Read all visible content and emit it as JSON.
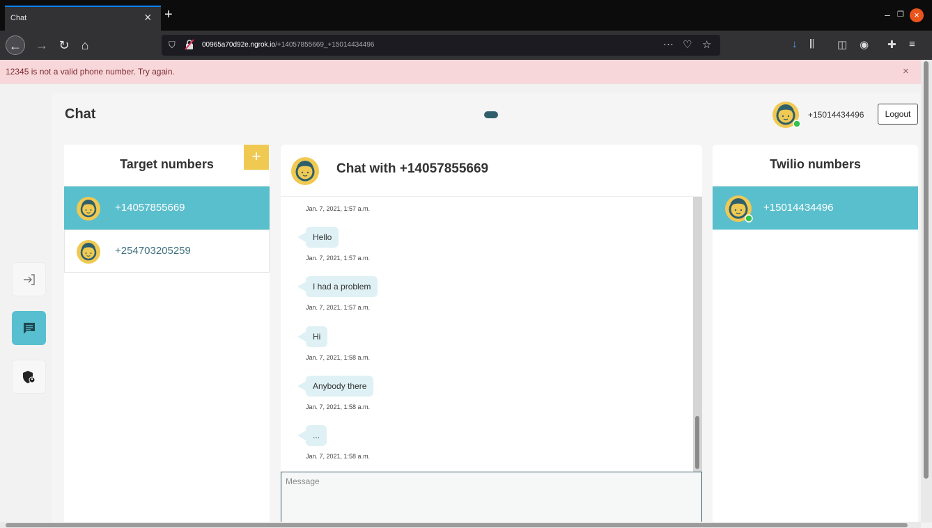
{
  "browser": {
    "tab_title": "Chat",
    "url_host": "00965a70d92e.ngrok.io",
    "url_path": "/+14057855669_+15014434496"
  },
  "alert": {
    "message": "12345 is not a valid phone number. Try again.",
    "close": "×"
  },
  "app": {
    "title": "Chat",
    "user_number": "+15014434496",
    "logout_label": "Logout"
  },
  "target_panel": {
    "title": "Target numbers",
    "add_label": "+",
    "items": [
      {
        "number": "+14057855669",
        "selected": true
      },
      {
        "number": "+254703205259",
        "selected": false
      }
    ]
  },
  "chat": {
    "title": "Chat with +14057855669",
    "first_timestamp": "Jan. 7, 2021, 1:57 a.m.",
    "messages": [
      {
        "text": "Hello",
        "time": "Jan. 7, 2021, 1:57 a.m."
      },
      {
        "text": "I had a problem",
        "time": "Jan. 7, 2021, 1:57 a.m."
      },
      {
        "text": "Hi",
        "time": "Jan. 7, 2021, 1:58 a.m."
      },
      {
        "text": "Anybody there",
        "time": "Jan. 7, 2021, 1:58 a.m."
      },
      {
        "text": "...",
        "time": "Jan. 7, 2021, 1:58 a.m."
      }
    ],
    "input_placeholder": "Message"
  },
  "twilio_panel": {
    "title": "Twilio numbers",
    "items": [
      {
        "number": "+15014434496",
        "selected": true
      }
    ]
  },
  "colors": {
    "accent": "#5abfcd",
    "add_button": "#f0c952",
    "alert_bg": "#f8d7da",
    "avatar_face": "#f0c952",
    "avatar_ring": "#2f5f6b",
    "online_dot": "#33c24d"
  }
}
